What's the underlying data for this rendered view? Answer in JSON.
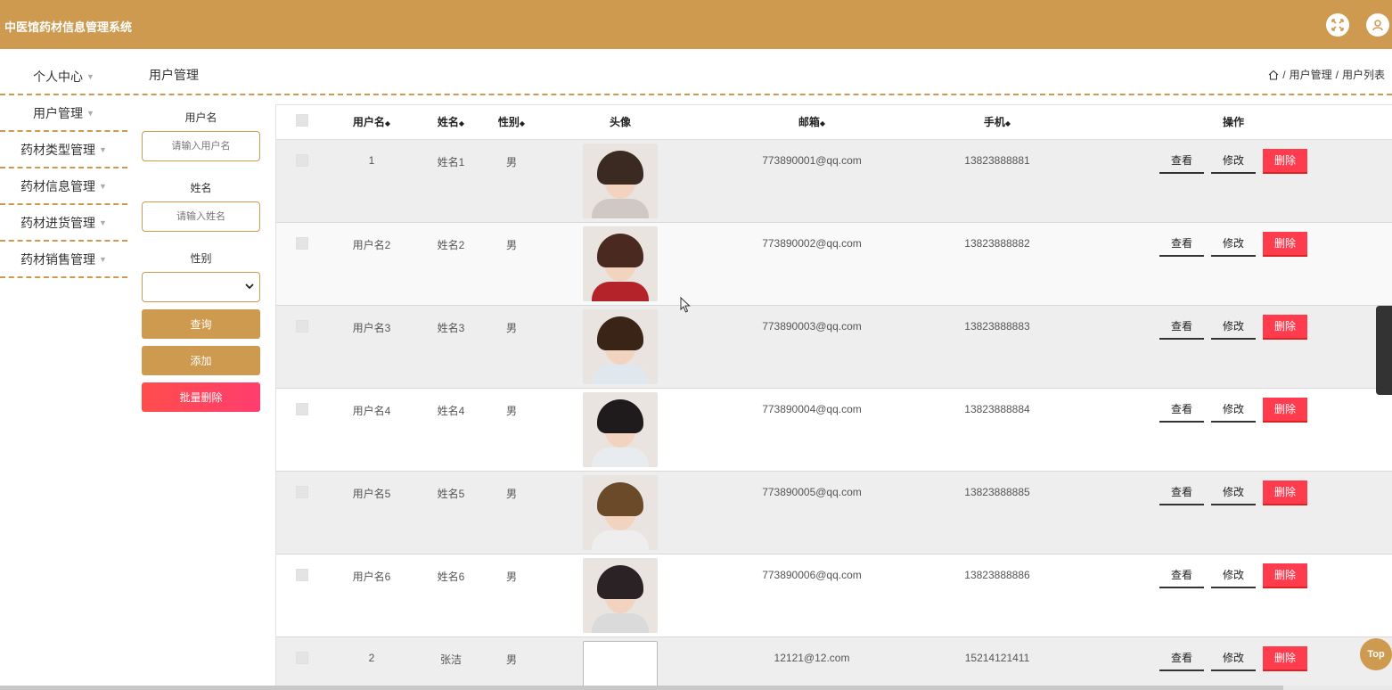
{
  "app": {
    "title": "中医馆药材信息管理系统"
  },
  "header": {
    "fullscreen_icon": "fullscreen-icon",
    "user_icon": "user-icon"
  },
  "sidebar": {
    "items": [
      {
        "label": "个人中心"
      },
      {
        "label": "用户管理"
      },
      {
        "label": "药材类型管理"
      },
      {
        "label": "药材信息管理"
      },
      {
        "label": "药材进货管理"
      },
      {
        "label": "药材销售管理"
      }
    ]
  },
  "page": {
    "title": "用户管理"
  },
  "breadcrumb": {
    "level1": "用户管理",
    "level2": "用户列表",
    "sep": "/"
  },
  "search": {
    "username_label": "用户名",
    "username_placeholder": "请输入用户名",
    "name_label": "姓名",
    "name_placeholder": "请输入姓名",
    "gender_label": "性别",
    "gender_value": "",
    "query_button": "查询",
    "add_button": "添加",
    "batch_delete_button": "批量删除"
  },
  "table": {
    "columns": [
      "用户名",
      "姓名",
      "性别",
      "头像",
      "邮箱",
      "手机",
      "操作"
    ],
    "sort_glyph": "◆",
    "rows": [
      {
        "username": "1",
        "name": "姓名1",
        "gender": "男",
        "email": "773890001@qq.com",
        "phone": "13823888881",
        "avatar_color": "#3a2a22",
        "body_color": "#cfc8c4"
      },
      {
        "username": "用户名2",
        "name": "姓名2",
        "gender": "男",
        "email": "773890002@qq.com",
        "phone": "13823888882",
        "avatar_color": "#4a2a20",
        "body_color": "#b5232a"
      },
      {
        "username": "用户名3",
        "name": "姓名3",
        "gender": "男",
        "email": "773890003@qq.com",
        "phone": "13823888883",
        "avatar_color": "#3a2418",
        "body_color": "#dfe8ef"
      },
      {
        "username": "用户名4",
        "name": "姓名4",
        "gender": "男",
        "email": "773890004@qq.com",
        "phone": "13823888884",
        "avatar_color": "#1f1a1c",
        "body_color": "#e8ecef"
      },
      {
        "username": "用户名5",
        "name": "姓名5",
        "gender": "男",
        "email": "773890005@qq.com",
        "phone": "13823888885",
        "avatar_color": "#6b4a2a",
        "body_color": "#eeeeee"
      },
      {
        "username": "用户名6",
        "name": "姓名6",
        "gender": "男",
        "email": "773890006@qq.com",
        "phone": "13823888886",
        "avatar_color": "#2a2224",
        "body_color": "#dadada"
      },
      {
        "username": "2",
        "name": "张洁",
        "gender": "男",
        "email": "12121@12.com",
        "phone": "15214121411",
        "avatar_color": "",
        "body_color": ""
      }
    ],
    "actions": {
      "view": "查看",
      "edit": "修改",
      "delete": "删除"
    }
  },
  "float": {
    "top_button": "Top"
  }
}
